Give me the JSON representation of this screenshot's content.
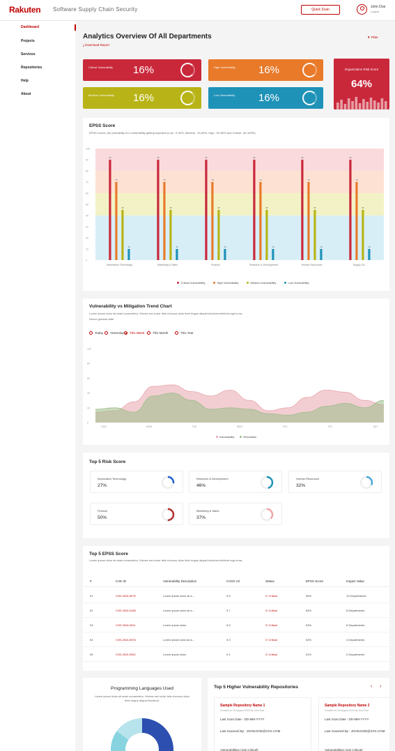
{
  "header": {
    "logo": "Rakuten",
    "title": "Software Supply Chain Security",
    "quick_scan": "Quick Scan",
    "user_name": "John Doe",
    "user_role": "Logout"
  },
  "sidebar": {
    "items": [
      {
        "label": "Dashboard"
      },
      {
        "label": "Projects"
      },
      {
        "label": "Services"
      },
      {
        "label": "Repositories"
      },
      {
        "label": "Help"
      },
      {
        "label": "About"
      }
    ]
  },
  "page": {
    "title": "Analytics Overview Of All Departments",
    "download": "Download Report",
    "filter": "Filter"
  },
  "kpis": [
    {
      "label": "Critical Vulnerability",
      "value": "16%",
      "color": "#c9283b",
      "progress": 0.16
    },
    {
      "label": "High Vulnerability",
      "value": "16%",
      "color": "#e87a2a",
      "progress": 0.16
    },
    {
      "label": "Medium Vulnerability",
      "value": "16%",
      "color": "#b8b417",
      "progress": 0.16
    },
    {
      "label": "Low Vulnerability",
      "value": "16%",
      "color": "#1f92b8",
      "progress": 0.16
    }
  ],
  "org_risk": {
    "label": "Organization Risk Score",
    "value": "64%"
  },
  "epss": {
    "title": "EPSS Score",
    "subtitle": "EPSS scores, the probability of a vulnerability getting exploited (Low : 0-40%, Medium : 40-60%, High : 60-80% and Critical : 80-100%)",
    "chart_data": {
      "type": "bar",
      "ylim": [
        0,
        100
      ],
      "yticks": [
        "100",
        "90",
        "80",
        "70",
        "60",
        "50",
        "40",
        "30",
        "20",
        "10",
        "0"
      ],
      "bands": [
        {
          "from": 80,
          "to": 100,
          "color": "#fadadd"
        },
        {
          "from": 60,
          "to": 80,
          "color": "#fde2d3"
        },
        {
          "from": 40,
          "to": 60,
          "color": "#f2f2c6"
        },
        {
          "from": 0,
          "to": 40,
          "color": "#d8eef7"
        }
      ],
      "categories": [
        "Information Technology",
        "Marketing & Sales",
        "Finance",
        "Research & Development",
        "Human Resources",
        "Supply Ch..."
      ],
      "series": [
        {
          "name": "Critical Vulnerability",
          "color": "#c9283b",
          "values": [
            90,
            90,
            90,
            90,
            90,
            90
          ]
        },
        {
          "name": "High Vulnerability",
          "color": "#e87a2a",
          "values": [
            70,
            70,
            70,
            70,
            70,
            70
          ]
        },
        {
          "name": "Medium Vulnerability",
          "color": "#b8b417",
          "values": [
            45,
            45,
            45,
            45,
            45,
            45
          ]
        },
        {
          "name": "Low Vulnerability",
          "color": "#1f92b8",
          "values": [
            10,
            10,
            10,
            10,
            10,
            10
          ]
        }
      ]
    }
  },
  "trend": {
    "title": "Vulnerability vs Mitigation Trend Chart",
    "subtitle": "Lorem ipsum dolor sit amet consectetur. Viverra nec tortor felis rhoncus dolor fleet ringue aliquet tincidunt eleifend eget urna.",
    "subtitle2": "Donec gravida vitae.",
    "ranges": [
      {
        "label": "Today",
        "selected": false
      },
      {
        "label": "Yesterday",
        "selected": false
      },
      {
        "label": "This Week",
        "selected": true
      },
      {
        "label": "This Month",
        "selected": false
      },
      {
        "label": "This Year",
        "selected": false
      }
    ],
    "chart_data": {
      "type": "area",
      "ylim": [
        0,
        100
      ],
      "yticks": [
        "100",
        "80",
        "60",
        "40",
        "20",
        "0"
      ],
      "xticks": [
        "SUN",
        "MON",
        "TUE",
        "WED",
        "THU",
        "FRI",
        "SAT"
      ],
      "series": [
        {
          "name": "Vulnerability",
          "color": "#e8a6ad",
          "values": [
            14,
            16,
            28,
            49,
            51,
            42,
            36,
            44,
            30,
            16,
            20,
            34,
            44,
            41,
            30,
            24
          ]
        },
        {
          "name": "Resolution",
          "color": "#9dbd8a",
          "values": [
            18,
            20,
            14,
            36,
            40,
            30,
            18,
            20,
            18,
            12,
            10,
            14,
            22,
            26,
            20,
            30
          ]
        }
      ]
    }
  },
  "risk": {
    "title": "Top 5 Risk Score",
    "items": [
      {
        "name": "Information Technology",
        "pct": "27%",
        "value": 0.27,
        "color": "#1f5fcf"
      },
      {
        "name": "Research & Development",
        "pct": "46%",
        "value": 0.46,
        "color": "#1f92b8"
      },
      {
        "name": "Human Resources",
        "pct": "32%",
        "value": 0.32,
        "color": "#4aa7d6"
      },
      {
        "name": "Finance",
        "pct": "50%",
        "value": 0.5,
        "color": "#b5302e"
      },
      {
        "name": "Marketing & Sales",
        "pct": "37%",
        "value": 0.37,
        "color": "#f0a5a5"
      }
    ]
  },
  "top_epss": {
    "title": "Top 5 EPSS Score",
    "subtitle": "Lorem ipsum dolor sit amet consectetur. Viverra nec tortor felis rhoncus dolor fleet ringue aliquet tincidunt eleifend eget urna.",
    "headers": [
      "#",
      "CVE ID",
      "Vulnerability Description",
      "CVSS V3",
      "Status",
      "EPSS Score",
      "Impact Value"
    ],
    "rows": [
      {
        "n": "01",
        "cve": "CVE-2024-0075",
        "desc": "Lorem ipsum dolor sit a...",
        "cvss": "9.9",
        "status": "Critical",
        "epss": "55%",
        "impact": "10 Departments"
      },
      {
        "n": "02",
        "cve": "CVE-2024-0158",
        "desc": "Lorem ipsum dolor sit a...",
        "cvss": "9.7",
        "status": "Critical",
        "epss": "54%",
        "impact": "8 Departments"
      },
      {
        "n": "03",
        "cve": "CVE-2024-0011",
        "desc": "Lorem ipsum dolor",
        "cvss": "9.5",
        "status": "Critical",
        "epss": "53%",
        "impact": "6 Departments"
      },
      {
        "n": "04",
        "cve": "CVE-2024-0076",
        "desc": "Lorem ipsum dolor sit a...",
        "cvss": "9.3",
        "status": "Critical",
        "epss": "52%",
        "impact": "4 Departments"
      },
      {
        "n": "05",
        "cve": "CVE-2024-0042",
        "desc": "Lorem ipsum dolor",
        "cvss": "9.1",
        "status": "Critical",
        "epss": "51%",
        "impact": "2 Departments"
      }
    ]
  },
  "languages": {
    "title": "Programming Languages Used",
    "subtitle": "Lorem ipsum dolor sit amet consectetur. Viverra nec tortor felis rhoncus dolor fleet ringue aliquet tincidunt.",
    "chart_data": {
      "type": "pie",
      "values": [
        40,
        25,
        20,
        15
      ],
      "colors": [
        "#2d4fb0",
        "#54a9e8",
        "#87d3e0",
        "#b7e3ec"
      ]
    }
  },
  "repos": {
    "title": "Top 5 Higher Vulnerability Repositories",
    "cards": [
      {
        "name": "Sample Repository Name 1",
        "sub": "Created on 15 August 2023 by John Doe",
        "scan": "Last Scan Date : DD-MM-YYYY",
        "by": "Last Scanned By : JOHN.DOE@XXX.COM",
        "vul": "Vulnerabilities (102 Critical)"
      },
      {
        "name": "Sample Repository Name 2",
        "sub": "Created on 15 August 2023 by John Doe",
        "scan": "Last Scan Date : DD-MM-YYYY",
        "by": "Last Scanned By : JOHN.DOE@XXX.COM",
        "vul": "Vulnerabilities (102 Critical)"
      }
    ]
  }
}
